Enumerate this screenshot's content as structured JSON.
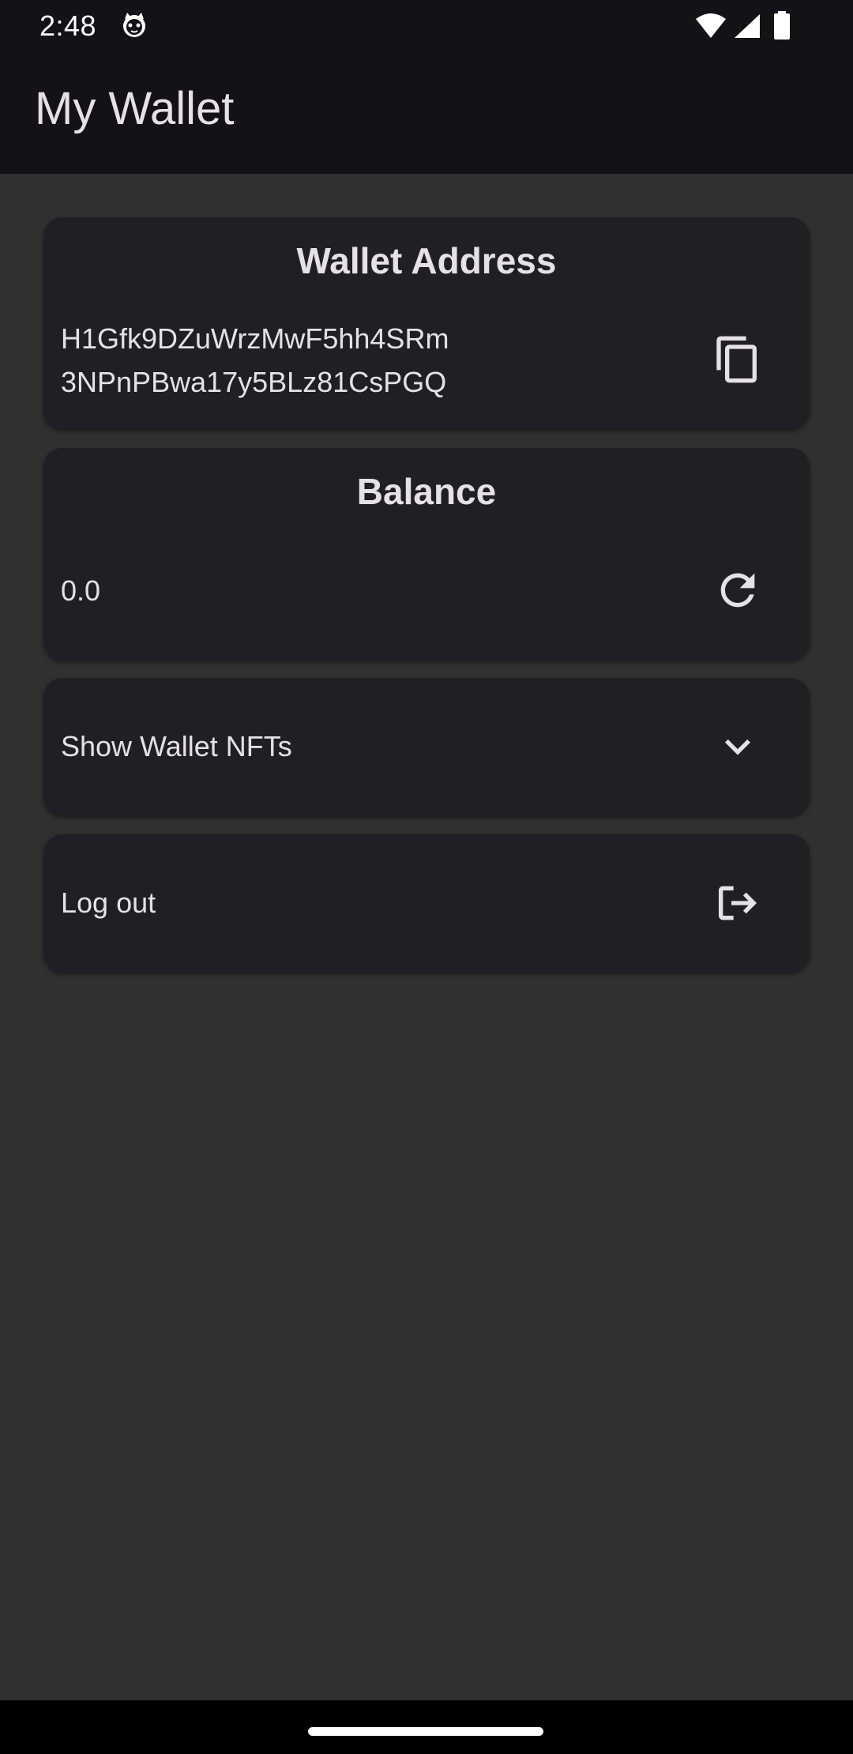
{
  "status_bar": {
    "time": "2:48",
    "notification_icon": "cat-face-icon",
    "wifi_icon": "wifi-icon",
    "signal_icon": "cellular-signal-icon",
    "battery_icon": "battery-icon"
  },
  "app_bar": {
    "title": "My Wallet"
  },
  "wallet_address_card": {
    "title": "Wallet Address",
    "address_line1": "H1Gfk9DZuWrzMwF5hh4SRm",
    "address_line2": "3NPnPBwa17y5BLz81CsPGQ",
    "icon": "copy-icon"
  },
  "balance_card": {
    "title": "Balance",
    "value": "0.0",
    "icon": "refresh-icon"
  },
  "nfts_card": {
    "label": "Show Wallet NFTs",
    "icon": "chevron-down-icon"
  },
  "logout_card": {
    "label": "Log out",
    "icon": "logout-icon"
  },
  "colors": {
    "background": "#303030",
    "bar": "#141218",
    "card": "#211f26",
    "text": "#e6e1e5"
  }
}
